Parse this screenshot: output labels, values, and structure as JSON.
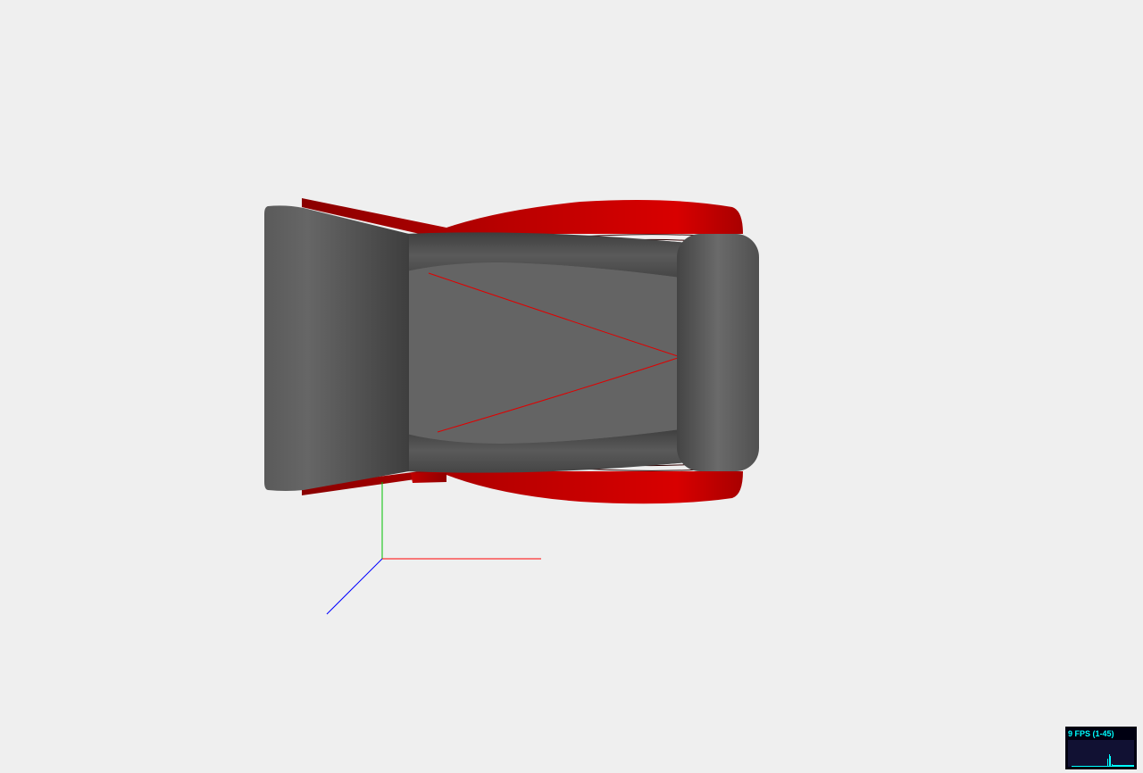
{
  "viewer": {
    "background": "#efefef",
    "model_colors": {
      "body_gray": "#5f5f5f",
      "body_gray_dark": "#3c3c3c",
      "shell_red": "#d40000",
      "shell_red_dark": "#8a0000"
    },
    "axes_colors": {
      "x": "#ff0000",
      "y": "#00c000",
      "z": "#0000ff"
    }
  },
  "stats": {
    "label": "9 FPS (1-45)",
    "fps": 9,
    "min": 1,
    "max": 45,
    "text_color": "#00ffff",
    "bg_color": "#000011",
    "history": [
      0.02,
      0.02,
      0.02,
      0.02,
      0.02,
      0.02,
      0.02,
      0.02,
      0.02,
      0.02,
      0.02,
      0.02,
      0.02,
      0.02,
      0.02,
      0.02,
      0.02,
      0.02,
      0.02,
      0.02,
      0.02,
      0.02,
      0.02,
      0.02,
      0.02,
      0.02,
      0.02,
      0.02,
      0.02,
      0.02,
      0.02,
      0.02,
      0.02,
      0.02,
      0.02,
      0.02,
      0.02,
      0.02,
      0.02,
      0.02,
      0.3,
      0.02,
      0.45,
      0.4,
      0.02,
      0.1,
      0.08,
      0.06,
      0.08,
      0.07,
      0.06,
      0.07,
      0.08,
      0.06,
      0.07,
      0.06,
      0.08,
      0.07,
      0.06,
      0.07,
      0.08,
      0.06,
      0.07,
      0.06,
      0.07,
      0.08,
      0.06,
      0.07,
      0.06,
      0.07
    ]
  }
}
